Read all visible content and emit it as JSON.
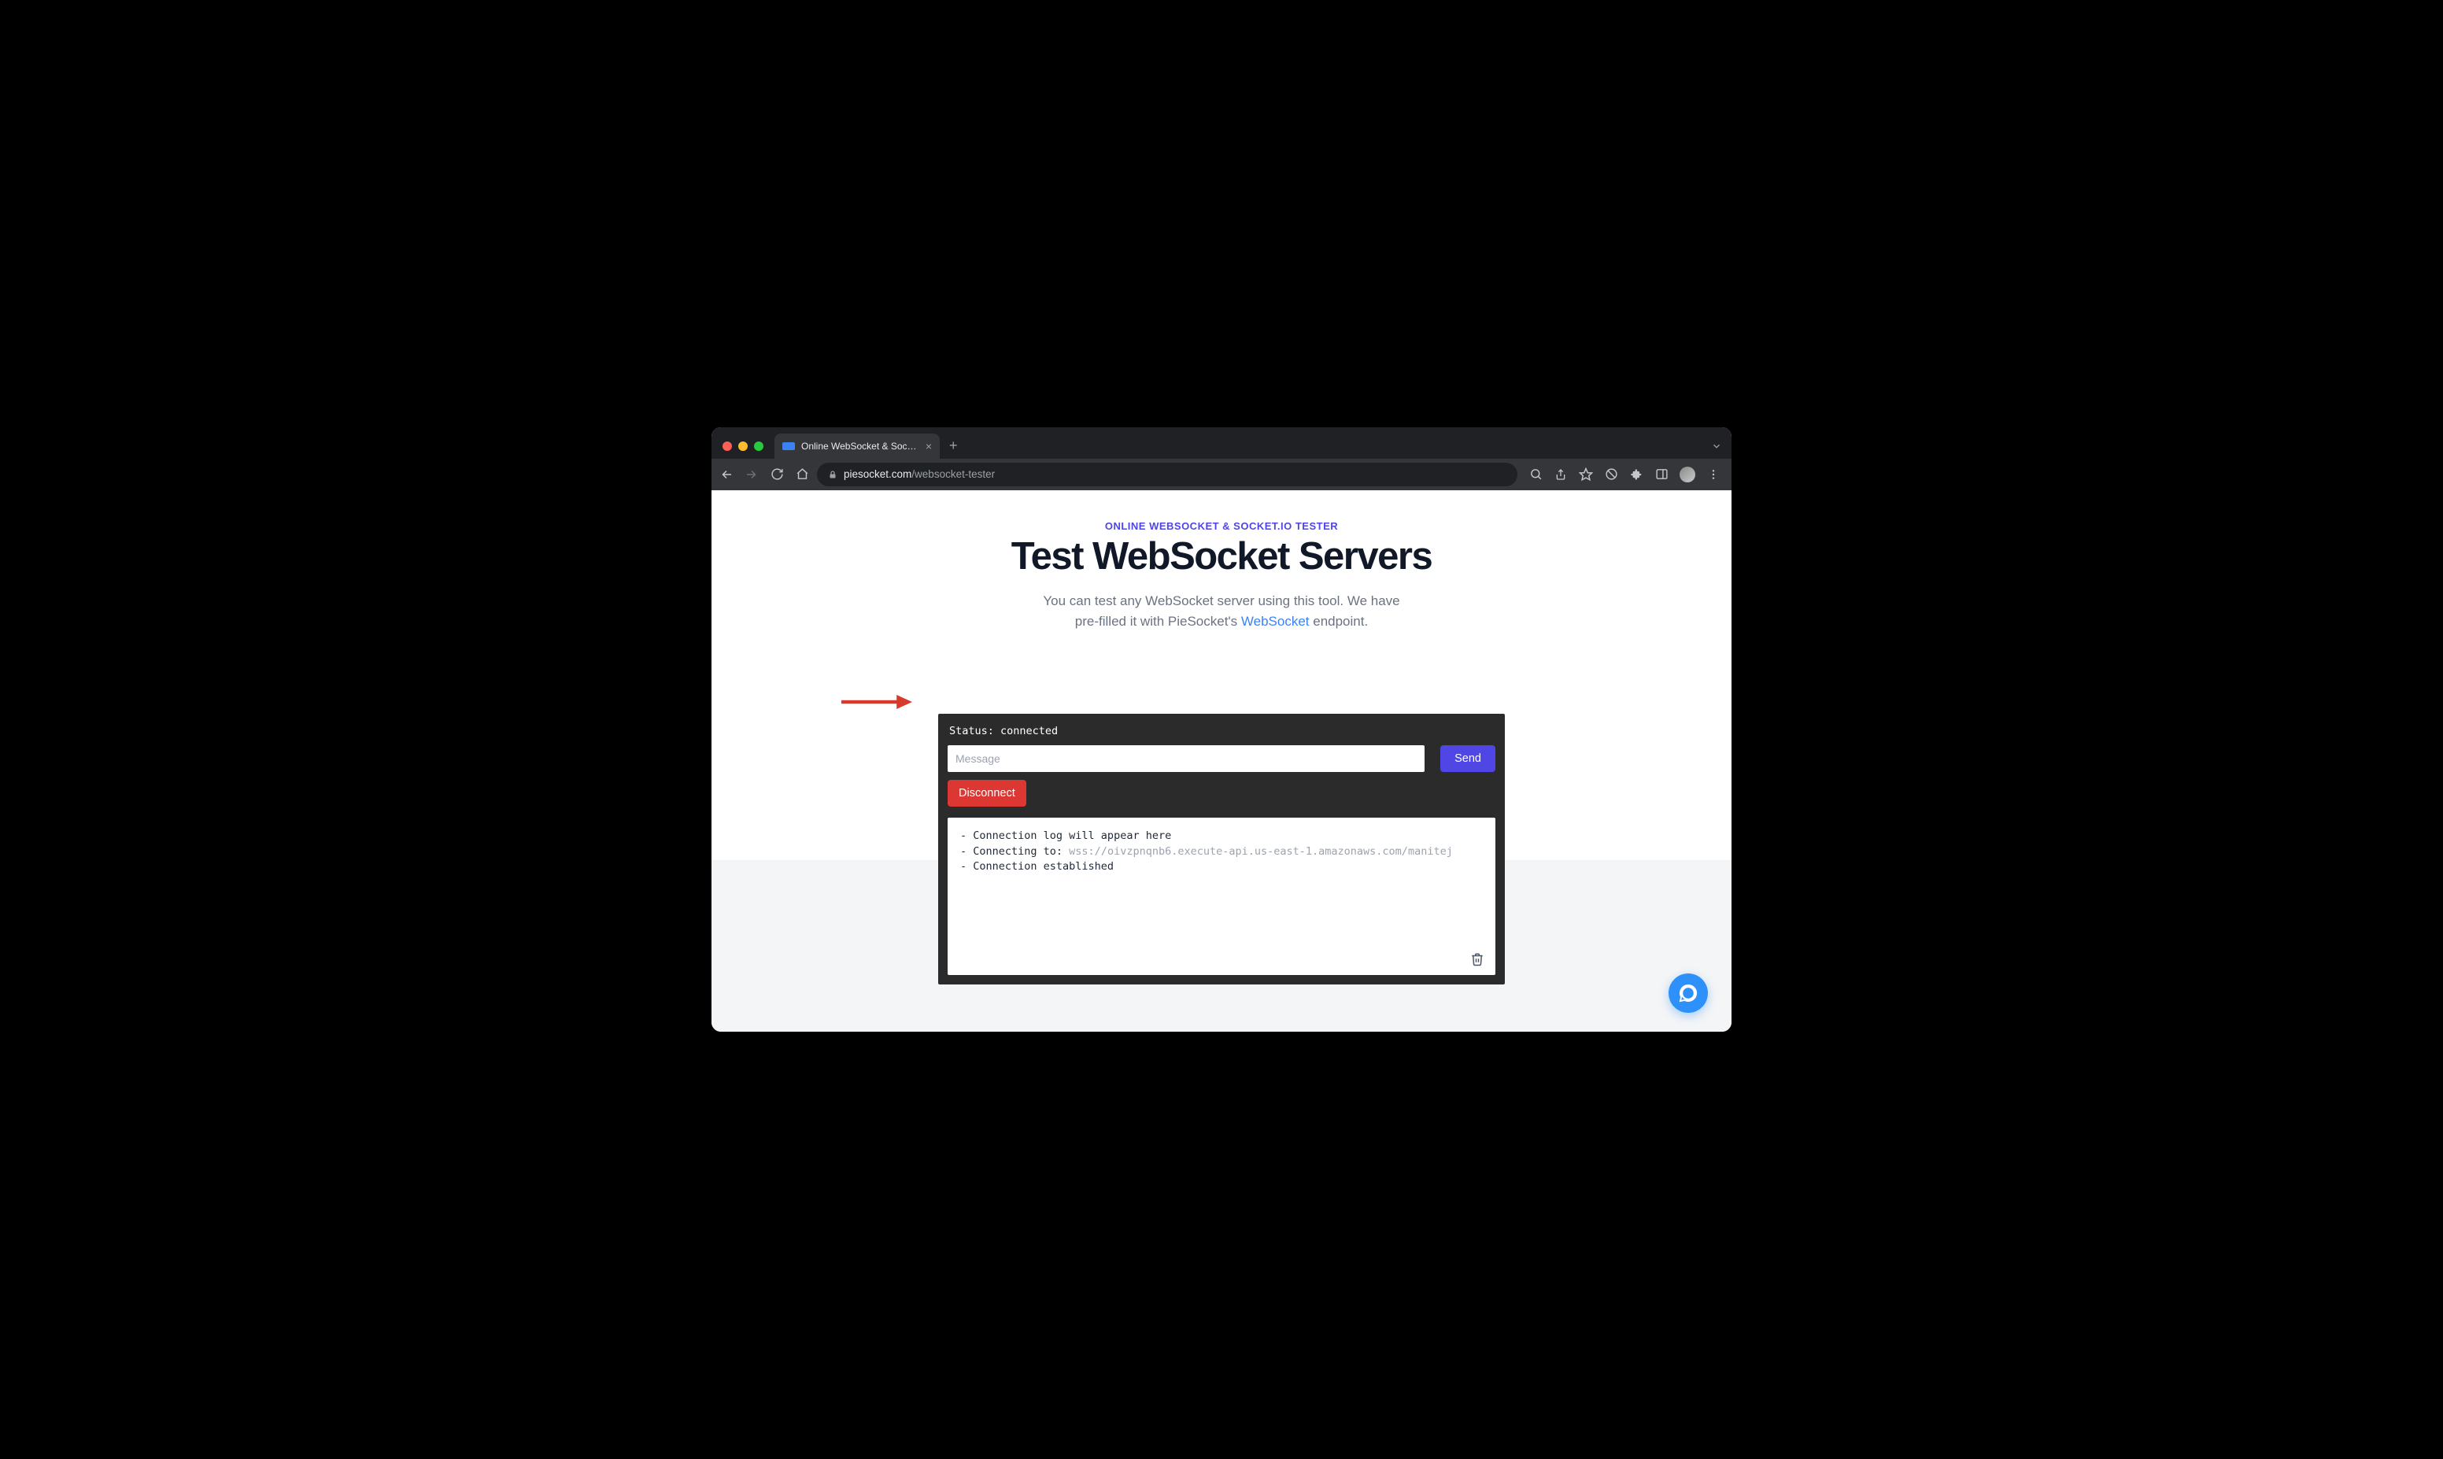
{
  "browser": {
    "tab_title": "Online WebSocket & Socket.io",
    "url_domain": "piesocket.com",
    "url_path": "/websocket-tester"
  },
  "page": {
    "eyebrow": "ONLINE WEBSOCKET & SOCKET.IO TESTER",
    "headline": "Test WebSocket Servers",
    "sub_pre": "You can test any WebSocket server using this tool. We have pre-filled it with PieSocket's ",
    "sub_link": "WebSocket",
    "sub_post": " endpoint."
  },
  "tester": {
    "status_label": "Status: ",
    "status_value": "connected",
    "message_placeholder": "Message",
    "send_label": "Send",
    "disconnect_label": "Disconnect",
    "log": {
      "l1": "- Connection log will appear here",
      "l2_prefix": "- Connecting to: ",
      "l2_url": "wss://oivzpnqnb6.execute-api.us-east-1.amazonaws.com/manitej",
      "l3": "- Connection established"
    }
  }
}
